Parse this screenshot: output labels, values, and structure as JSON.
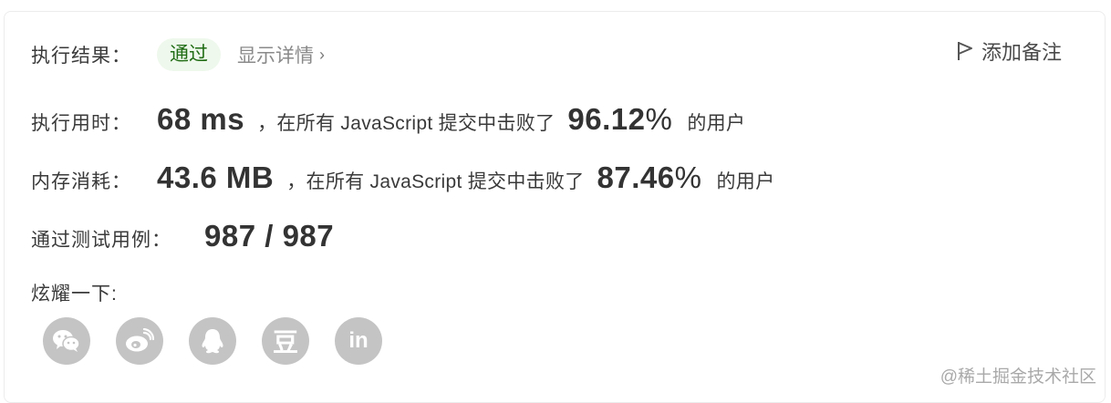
{
  "result": {
    "label": "执行结果：",
    "status": "通过",
    "details_link": "显示详情",
    "details_chevron": "›",
    "add_note": "添加备注"
  },
  "runtime": {
    "label": "执行用时：",
    "value": "68 ms",
    "middle_text": "，在所有 JavaScript 提交中击败了",
    "percent_number": "96.12",
    "percent_sign": "%",
    "suffix": "的用户"
  },
  "memory": {
    "label": "内存消耗：",
    "value": "43.6 MB",
    "middle_text": "，在所有 JavaScript 提交中击败了",
    "percent_number": "87.46",
    "percent_sign": "%",
    "suffix": "的用户"
  },
  "tests": {
    "label": "通过测试用例：",
    "value": "987 / 987"
  },
  "share": {
    "label": "炫耀一下:",
    "icons": [
      "wechat-icon",
      "weibo-icon",
      "qq-icon",
      "douban-icon",
      "linkedin-icon"
    ],
    "douban_glyph": "豆",
    "linkedin_glyph": "in",
    "icon_color": "#c4c4c4"
  },
  "watermark": "@稀土掘金技术社区"
}
